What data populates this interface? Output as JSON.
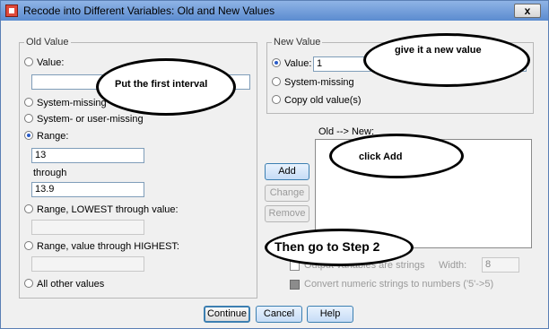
{
  "window": {
    "title": "Recode into Different Variables: Old and New Values",
    "close_label": "x"
  },
  "old_value": {
    "legend": "Old Value",
    "value_label": "Value:",
    "value_input": "",
    "system_missing_label": "System-missing",
    "system_user_missing_label": "System- or user-missing",
    "range_label": "Range:",
    "range_from": "13",
    "through_label": "through",
    "range_to": "13.9",
    "range_lowest_label": "Range, LOWEST through value:",
    "range_lowest_input": "",
    "range_highest_label": "Range, value through HIGHEST:",
    "range_highest_input": "",
    "all_other_label": "All other values",
    "selected": "range"
  },
  "new_value": {
    "legend": "New Value",
    "value_label": "Value:",
    "value_input": "1",
    "system_missing_label": "System-missing",
    "copy_old_label": "Copy old value(s)",
    "selected": "value"
  },
  "old_new": {
    "header": "Old --> New:",
    "items": []
  },
  "list_buttons": {
    "add": "Add",
    "change": "Change",
    "remove": "Remove"
  },
  "options": {
    "output_strings_label": "Output variables are strings",
    "width_label": "Width:",
    "width_value": "8",
    "convert_label": "Convert numeric strings to numbers ('5'->5)"
  },
  "footer": {
    "continue": "Continue",
    "cancel": "Cancel",
    "help": "Help"
  },
  "annotations": {
    "put_first_interval": "Put the first interval",
    "give_new_value": "give it a new value",
    "click_add": "click Add",
    "then_step2": "Then go to Step 2"
  },
  "colors": {
    "accent": "#2a5cc8",
    "titlebar": "#6a9ad8"
  }
}
